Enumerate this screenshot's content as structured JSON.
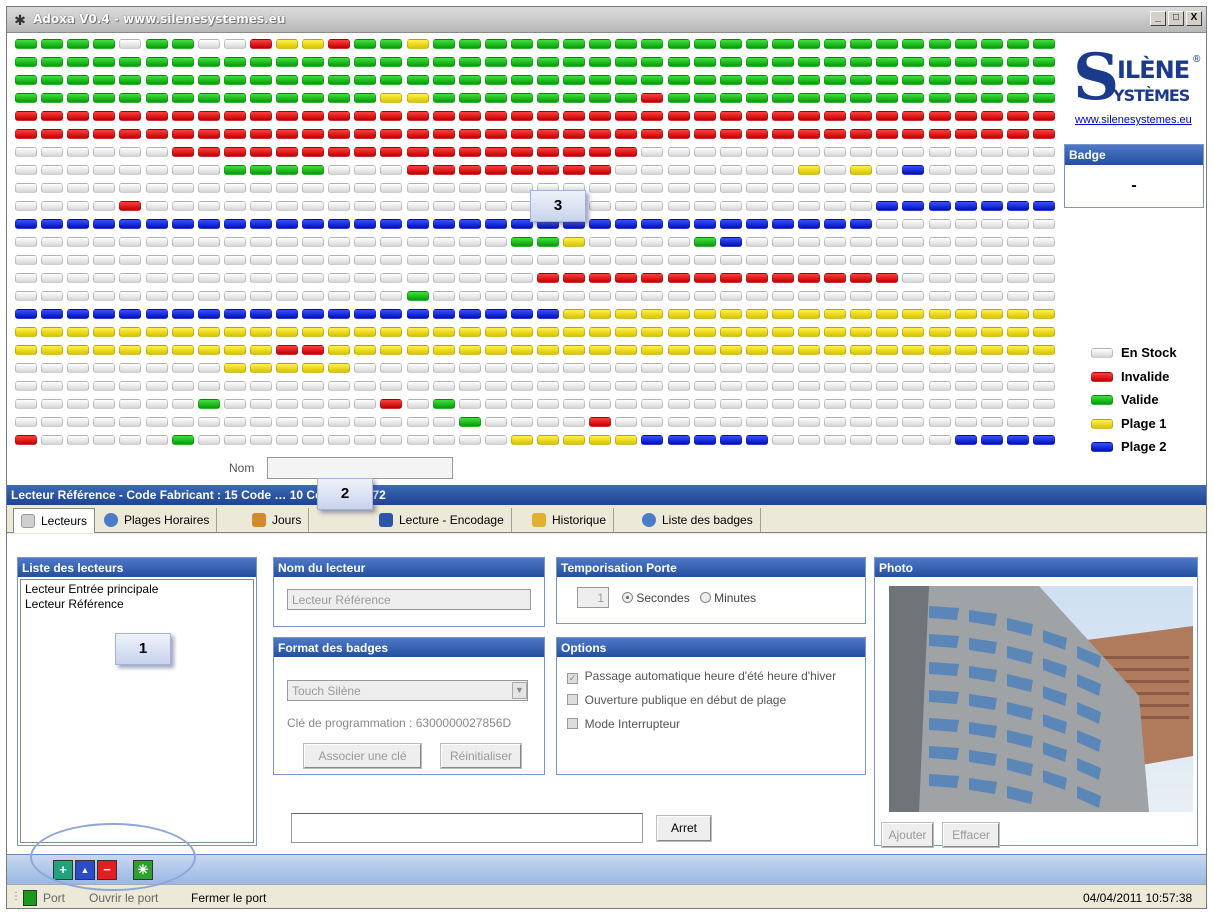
{
  "window": {
    "title": "Adoxa V0.4 - www.silenesystemes.eu",
    "min": "_",
    "max": "□",
    "close": "X"
  },
  "logo": {
    "letter_s": "S",
    "line1": "ILÈNE",
    "line2": "YSTÈMES",
    "reg": "®",
    "url": "www.silenesystemes.eu"
  },
  "badge_panel": {
    "title": "Badge",
    "value": "-"
  },
  "legend": [
    {
      "label": "En Stock",
      "state": 0
    },
    {
      "label": "Invalide",
      "state": 1
    },
    {
      "label": "Valide",
      "state": 2
    },
    {
      "label": "Plage 1",
      "state": 3
    },
    {
      "label": "Plage 2",
      "state": 4
    }
  ],
  "state_colors": {
    "0": "#e8e8e8",
    "1": "#e00000",
    "2": "#16c016",
    "3": "#f0dc00",
    "4": "#0a24e0"
  },
  "badge_grid": {
    "columns": 40,
    "rows": [
      "2222022001331223222222222222222222222222",
      "2222222222222222222222222222222222222222",
      "2222222222222222222222222222222222222222",
      "2222222222222233222222221222222222222222",
      "1111111111111111111111111111111111111111",
      "1111111111111111111111111111111111111111",
      "0000001111111111111111110000000000000000",
      "0000000022220001111111100000003030400000",
      "0000000000000000000000000000000000000000",
      "0000100000000000000000000000000004444444",
      "4444444444444444444444444444444440000000",
      "0000000000000000000223000024000000000000",
      "0000000000000000000000000000000000000000",
      "0000000000000000000011111111111111000000",
      "0000000000000002000000000000000000000000",
      "4444444444444444444443333333333333333333",
      "3333333333333333333333333333333333333333",
      "3333333333113333333333333333333333333333",
      "0000000033333000000000000000000000000000",
      "0000000000000000000000000000000000000000",
      "0000000200000010200000000000000000000000",
      "0000000000000000020000100000000000000000",
      "1000002000000000000333334444400000004444"
    ]
  },
  "nom": {
    "label": "Nom",
    "value": ""
  },
  "info_bar": "Lecteur Référence - Code Fabricant : 15 Code … 10 Code Site : 72",
  "tabs": [
    {
      "label": "Lecteurs",
      "icon": "reader-icon",
      "color": "#b9b9b9"
    },
    {
      "label": "Plages Horaires",
      "icon": "clock-icon",
      "color": "#4a7cc8"
    },
    {
      "label": "Jours",
      "icon": "calendar-icon",
      "color": "#d28a2c"
    },
    {
      "label": "Lecture - Encodage",
      "icon": "key-icon",
      "color": "#2c54a8"
    },
    {
      "label": "Historique",
      "icon": "history-icon",
      "color": "#e0b030"
    },
    {
      "label": "Liste des badges",
      "icon": "badges-icon",
      "color": "#4a7cc8"
    }
  ],
  "lecteurs_panel": {
    "title": "Liste des lecteurs",
    "items": [
      "Lecteur Entrée principale",
      "Lecteur Référence"
    ]
  },
  "nom_lecteur_panel": {
    "title": "Nom du lecteur",
    "value": "Lecteur Référence"
  },
  "format_panel": {
    "title": "Format des badges",
    "selected": "Touch Silène",
    "cle_label": "Clé de programmation : 6300000027856D",
    "btn_associer": "Associer une clé",
    "btn_reinit": "Réinitialiser"
  },
  "tempo_panel": {
    "title": "Temporisation Porte",
    "value": "1",
    "opt_secondes": "Secondes",
    "opt_minutes": "Minutes"
  },
  "options_panel": {
    "title": "Options",
    "items": [
      {
        "label": "Passage automatique heure d'été heure d'hiver",
        "checked": true
      },
      {
        "label": "Ouverture publique en début de plage",
        "checked": false
      },
      {
        "label": "Mode Interrupteur",
        "checked": false
      }
    ]
  },
  "photo_panel": {
    "title": "Photo",
    "btn_ajouter": "Ajouter",
    "btn_effacer": "Effacer"
  },
  "arret_button": "Arret",
  "toolbar": {
    "add": "+",
    "up": "▲",
    "remove": "−",
    "refresh": "✳"
  },
  "status": {
    "port_label": "Port",
    "open_port": "Ouvrir le port",
    "close_port": "Fermer le port",
    "datetime": "04/04/2011 10:57:38"
  },
  "callouts": {
    "c1": "1",
    "c2": "2",
    "c3": "3"
  }
}
